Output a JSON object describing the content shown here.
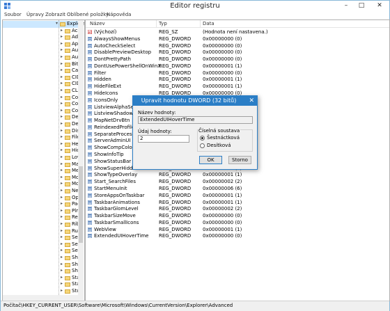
{
  "window": {
    "title": "Editor registru"
  },
  "window_controls": {
    "minimize": "–",
    "maximize": "□",
    "close": "✕"
  },
  "menu": [
    "Soubor",
    "Úpravy",
    "Zobrazit",
    "Oblíbené položky",
    "Nápověda"
  ],
  "tree": {
    "items": [
      "Explore",
      "Acc",
      "Adv",
      "App",
      "Aut",
      "Aut",
      "BitE",
      "Cab",
      "CID",
      "CID",
      "CLS",
      "Cor",
      "Cor",
      "Cor",
      "Des",
      "Des",
      "Disc",
      "File",
      "Hel",
      "Hid",
      "Lov",
      "Ma",
      "Me",
      "Mo",
      "Mo",
      "Nev",
      "Ope",
      "Pac",
      "Plm",
      "Rec",
      "Ribl",
      "Rur",
      "Sea",
      "Sea",
      "Ses",
      "Sha",
      "Sha",
      "Shu",
      "Star",
      "Star",
      "Stu"
    ],
    "selected_index": 0
  },
  "list": {
    "columns": [
      "Název",
      "Typ",
      "Data"
    ],
    "rows": [
      {
        "name": "(Výchozí)",
        "type": "REG_SZ",
        "data": "(Hodnota není nastavena.)",
        "kind": "sz"
      },
      {
        "name": "AlwaysShowMenus",
        "type": "REG_DWORD",
        "data": "0x00000000 (0)",
        "kind": "dw"
      },
      {
        "name": "AutoCheckSelect",
        "type": "REG_DWORD",
        "data": "0x00000000 (0)",
        "kind": "dw"
      },
      {
        "name": "DisablePreviewDesktop",
        "type": "REG_DWORD",
        "data": "0x00000000 (0)",
        "kind": "dw"
      },
      {
        "name": "DontPrettyPath",
        "type": "REG_DWORD",
        "data": "0x00000000 (0)",
        "kind": "dw"
      },
      {
        "name": "DontUsePowerShellOnWinX",
        "type": "REG_DWORD",
        "data": "0x00000001 (1)",
        "kind": "dw"
      },
      {
        "name": "Filter",
        "type": "REG_DWORD",
        "data": "0x00000000 (0)",
        "kind": "dw"
      },
      {
        "name": "Hidden",
        "type": "REG_DWORD",
        "data": "0x00000001 (1)",
        "kind": "dw"
      },
      {
        "name": "HideFileExt",
        "type": "REG_DWORD",
        "data": "0x00000001 (1)",
        "kind": "dw"
      },
      {
        "name": "HideIcons",
        "type": "REG_DWORD",
        "data": "0x00000000 (0)",
        "kind": "dw"
      },
      {
        "name": "IconsOnly",
        "type": "",
        "data": "",
        "kind": "dw"
      },
      {
        "name": "ListviewAlphaSelect",
        "type": "",
        "data": "",
        "kind": "dw"
      },
      {
        "name": "ListviewShadow",
        "type": "",
        "data": "",
        "kind": "dw"
      },
      {
        "name": "MapNetDrvBtn",
        "type": "",
        "data": "",
        "kind": "dw"
      },
      {
        "name": "ReindexedProfile",
        "type": "",
        "data": "",
        "kind": "dw"
      },
      {
        "name": "SeparateProcess",
        "type": "",
        "data": "",
        "kind": "dw"
      },
      {
        "name": "ServerAdminUI",
        "type": "",
        "data": "",
        "kind": "dw"
      },
      {
        "name": "ShowCompColor",
        "type": "",
        "data": "",
        "kind": "dw"
      },
      {
        "name": "ShowInfoTip",
        "type": "",
        "data": "",
        "kind": "dw"
      },
      {
        "name": "ShowStatusBar",
        "type": "",
        "data": "",
        "kind": "dw"
      },
      {
        "name": "ShowSuperHidden",
        "type": "REG_DWORD",
        "data": "0x00000001 (1)",
        "kind": "dw"
      },
      {
        "name": "ShowTypeOverlay",
        "type": "REG_DWORD",
        "data": "0x00000001 (1)",
        "kind": "dw"
      },
      {
        "name": "Start_SearchFiles",
        "type": "REG_DWORD",
        "data": "0x00000002 (2)",
        "kind": "dw"
      },
      {
        "name": "StartMenuInit",
        "type": "REG_DWORD",
        "data": "0x00000006 (6)",
        "kind": "dw"
      },
      {
        "name": "StoreAppsOnTaskbar",
        "type": "REG_DWORD",
        "data": "0x00000001 (1)",
        "kind": "dw"
      },
      {
        "name": "TaskbarAnimations",
        "type": "REG_DWORD",
        "data": "0x00000001 (1)",
        "kind": "dw"
      },
      {
        "name": "TaskbarGlomLevel",
        "type": "REG_DWORD",
        "data": "0x00000002 (2)",
        "kind": "dw"
      },
      {
        "name": "TaskbarSizeMove",
        "type": "REG_DWORD",
        "data": "0x00000000 (0)",
        "kind": "dw"
      },
      {
        "name": "TaskbarSmallIcons",
        "type": "REG_DWORD",
        "data": "0x00000000 (0)",
        "kind": "dw"
      },
      {
        "name": "WebView",
        "type": "REG_DWORD",
        "data": "0x00000001 (1)",
        "kind": "dw"
      },
      {
        "name": "ExtendedUIHoverTime",
        "type": "REG_DWORD",
        "data": "0x00000000 (0)",
        "kind": "dw"
      }
    ]
  },
  "status": {
    "path": "Počítač\\HKEY_CURRENT_USER\\Software\\Microsoft\\Windows\\CurrentVersion\\Explorer\\Advanced"
  },
  "dialog": {
    "title": "Upravit hodnotu DWORD (32 bitů)",
    "close": "✕",
    "name_label": "Název hodnoty:",
    "name_value": "ExtendedUIHoverTime",
    "data_label": "Údaj hodnoty:",
    "data_value": "2",
    "base_label": "Číselná soustava",
    "hex_label": "Šestnáctková",
    "dec_label": "Desítková",
    "ok": "OK",
    "cancel": "Storno"
  }
}
